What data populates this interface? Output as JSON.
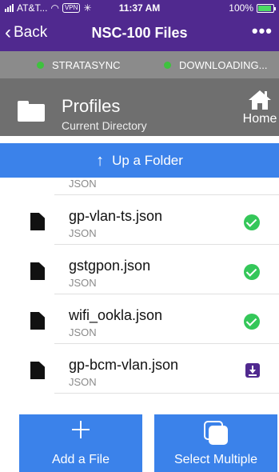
{
  "status_bar": {
    "carrier": "AT&T...",
    "vpn": "VPN",
    "time": "11:37 AM",
    "battery": "100%",
    "battery_level": 1.0
  },
  "nav": {
    "back_label": "Back",
    "title": "NSC-100 Files",
    "more_label": "•••"
  },
  "connections": [
    {
      "label": "STRATASYNC",
      "status_color": "#3ec23e"
    },
    {
      "label": "DOWNLOADING...",
      "status_color": "#3ec23e"
    }
  ],
  "directory": {
    "title": "Profiles",
    "subtitle": "Current Directory",
    "home_label": "Home"
  },
  "up_folder": {
    "label": "Up a Folder"
  },
  "files": [
    {
      "name": "",
      "type": "JSON",
      "status": "ok"
    },
    {
      "name": "gp-vlan-ts.json",
      "type": "JSON",
      "status": "ok"
    },
    {
      "name": "gstgpon.json",
      "type": "JSON",
      "status": "ok"
    },
    {
      "name": "wifi_ookla.json",
      "type": "JSON",
      "status": "ok"
    },
    {
      "name": "gp-bcm-vlan.json",
      "type": "JSON",
      "status": "download"
    }
  ],
  "actions": {
    "add_label": "Add a File",
    "select_label": "Select Multiple"
  },
  "colors": {
    "brand": "#50298f",
    "accent": "#3b82ea",
    "ok": "#34c759"
  }
}
